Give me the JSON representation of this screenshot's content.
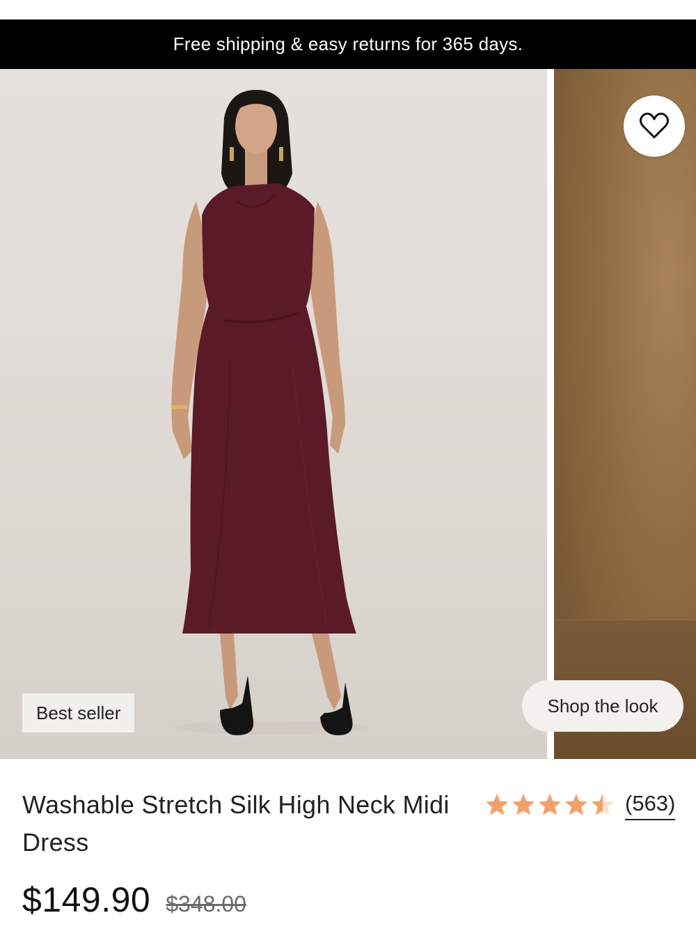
{
  "banner": {
    "text": "Free shipping & easy returns for 365 days."
  },
  "gallery": {
    "badge": "Best seller",
    "shop_look_label": "Shop the look",
    "wishlist_icon": "heart-icon",
    "dress_color": "#5a1a28"
  },
  "product": {
    "title": "Washable Stretch Silk High Neck Midi Dress",
    "rating": 4.5,
    "rating_max": 5,
    "review_count": "(563)",
    "star_color": "#f3a06b",
    "price_current": "$149.90",
    "price_original": "$348.00"
  }
}
